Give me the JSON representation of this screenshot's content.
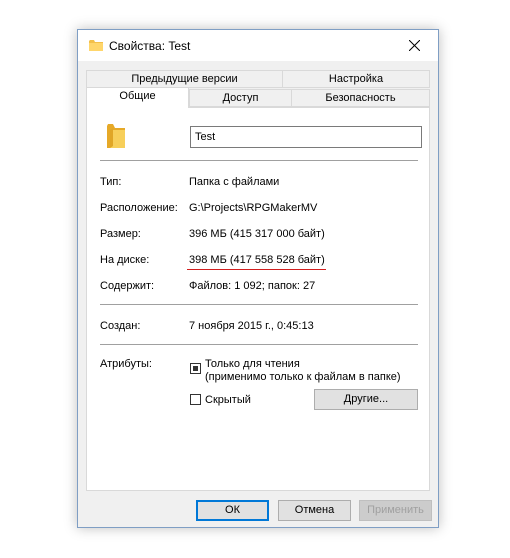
{
  "window": {
    "title": "Свойства: Test"
  },
  "tabs": {
    "row1": [
      "Предыдущие версии",
      "Настройка"
    ],
    "row2": [
      "Общие",
      "Доступ",
      "Безопасность"
    ],
    "active": "Общие"
  },
  "general": {
    "name_value": "Test",
    "type_label": "Тип:",
    "type_value": "Папка с файлами",
    "location_label": "Расположение:",
    "location_value": "G:\\Projects\\RPGMakerMV",
    "size_label": "Размер:",
    "size_value": "396 МБ (415 317 000 байт)",
    "disk_label": "На диске:",
    "disk_value": "398 МБ (417 558 528 байт)",
    "contains_label": "Содержит:",
    "contains_value": "Файлов: 1 092; папок: 27",
    "created_label": "Создан:",
    "created_value": "7 ноября 2015 г., 0:45:13",
    "attributes_label": "Атрибуты:",
    "readonly_line1": "Только для чтения",
    "readonly_line2": "(применимо только к файлам в папке)",
    "readonly_state": "indeterminate",
    "hidden_label": "Скрытый",
    "hidden_state": "unchecked",
    "other_button": "Другие..."
  },
  "buttons": {
    "ok": "ОК",
    "cancel": "Отмена",
    "apply": "Применить"
  },
  "colors": {
    "folder": "#f3c04a",
    "focus_border": "#0078d7",
    "annotation_underline": "#d21e1e"
  }
}
